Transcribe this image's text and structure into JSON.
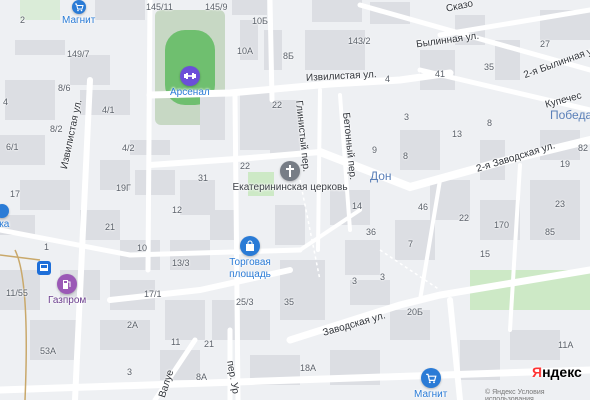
{
  "streets": {
    "izvilistaya_horizontal": "Извилистая ул.",
    "izvilistaya_vertical": "Извилистая ул.",
    "glinisty": "Глинистый пер.",
    "betonny": "Бетонный пер.",
    "zavodskaya": "Заводская ул.",
    "zavodskaya_2": "2-я Заводская ул.",
    "bylinnaya": "Былинная ул.",
    "bylinnaya_2": "2-я Былинная ул",
    "kupech": "Купечес",
    "skazo": "Сказо",
    "valu": "Валуе",
    "ur": "пер. Ур"
  },
  "districts": {
    "don": "Дон",
    "pobeda": "Победа"
  },
  "pois": {
    "magnit_top": "Магнит",
    "magnit_bottom": "Магнит",
    "arsenal": "Арсенал",
    "church": "Екатерининская церковь",
    "mall": "Торговая площадь",
    "gazprom": "Газпром",
    "pharmacy": "чка"
  },
  "house_numbers": [
    "145/11",
    "145/9",
    "10Б",
    "10А",
    "8Б",
    "143/2",
    "149/7",
    "8/6",
    "4/1",
    "22",
    "8/2",
    "6/1",
    "4/2",
    "4",
    "22",
    "31",
    "19Г",
    "12",
    "21",
    "10",
    "17/1",
    "13/3",
    "11/55",
    "2А",
    "25/3",
    "35",
    "21",
    "11",
    "53А",
    "8А",
    "18А",
    "3",
    "20Б",
    "3",
    "3",
    "36",
    "14",
    "9",
    "8",
    "3",
    "7",
    "46",
    "4",
    "41",
    "35",
    "13",
    "8",
    "82",
    "22",
    "170",
    "85",
    "11А",
    "2",
    "1",
    "17",
    "23",
    "15",
    "27",
    "19"
  ],
  "branding": {
    "yandex_ya": "Я",
    "yandex_rest": "ндекс",
    "copyright": "© Яндекс Условия использования"
  },
  "colors": {
    "background": "#eef0f3",
    "building": "#dcdee3",
    "road_major": "#ffffff",
    "park": "#cde9c6",
    "stadium_field": "#6fbf6f",
    "mall_icon": "#2a7bd6",
    "sport_icon": "#6b4fd8",
    "gazprom_icon": "#9b59b6",
    "magnit_icon": "#2a7bd6",
    "church_icon": "#777d86",
    "metro": "#1e6fd9"
  }
}
